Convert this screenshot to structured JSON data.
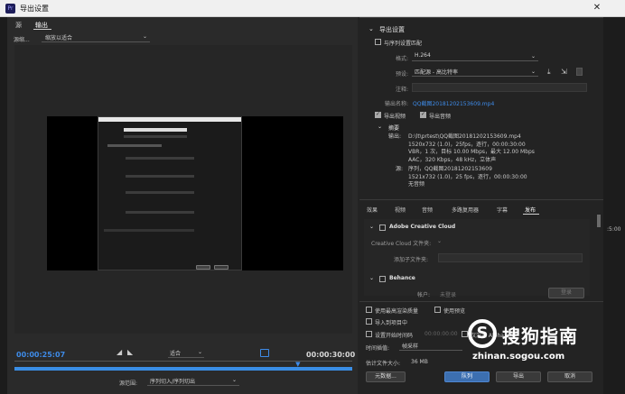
{
  "window": {
    "title": "导出设置",
    "close_glyph": "✕"
  },
  "left": {
    "tabs": {
      "source": "源",
      "output": "输出"
    },
    "scale_label": "源缩...",
    "scale_value": "缩放以适合",
    "timecode_current": "00:00:25:07",
    "timecode_end": "00:00:30:00",
    "fit_value": "适合",
    "range_label": "源范围:",
    "range_value": "序列切入/序列切出",
    "playhead_fraction": 0.84
  },
  "right": {
    "export_settings_header": "导出设置",
    "match_sequence_label": "与序列设置匹配",
    "format_label": "格式:",
    "format_value": "H.264",
    "preset_label": "预设:",
    "preset_value": "匹配源 - 高比特率",
    "comment_label": "注释:",
    "output_name_label": "输出名称:",
    "output_name_value": "QQ截图20181202153609.mp4",
    "export_video_label": "导出视频",
    "export_audio_label": "导出音频",
    "summary_header": "摘要",
    "summary_output_label": "输出:",
    "summary_output_lines": [
      "D:\\lt\\prtest\\QQ截图20181202153609.mp4",
      "1520x732 (1.0)，25fps，逐行，00:00:30:00",
      "VBR，1 次，目标 10.00 Mbps，最大 12.00 Mbps",
      "AAC，320 Kbps，48 kHz，立体声"
    ],
    "summary_source_label": "源:",
    "summary_source_lines": [
      "序列，QQ截图20181202153609",
      "1521x732 (1.0)，25 fps，逐行，00:00:30:00",
      "无音频"
    ],
    "tabs": [
      "效果",
      "视频",
      "音频",
      "多路复用器",
      "字幕",
      "发布"
    ],
    "active_tab": "发布",
    "adobe_cc_label": "Adobe Creative Cloud",
    "cc_folder_label": "Creative Cloud 文件夹:",
    "add_subfolder_label": "添加子文件夹:",
    "behance_label": "Behance",
    "account_label": "帐户:",
    "account_value": "未登录",
    "signin_button": "登录",
    "max_render_label": "使用最高渲染质量",
    "use_preview_label": "使用预览",
    "import_project_label": "导入到项目中",
    "set_start_tc_label": "设置开始时间码",
    "start_tc_value": "00:00:00:00",
    "render_alpha_label": "仅渲染 Alpha 通道",
    "time_interp_label": "时间插值:",
    "time_interp_value": "帧采样",
    "est_size_label": "估计文件大小:",
    "est_size_value": "36 MB",
    "metadata_button": "元数据...",
    "queue_button": "队列",
    "export_button": "导出",
    "cancel_button": "取消"
  },
  "side_labels": {
    "right_timecode": ":5:00"
  },
  "watermark": {
    "text": "搜狗指南",
    "url": "zhinan.sogou.com",
    "logo_glyph": "S"
  }
}
